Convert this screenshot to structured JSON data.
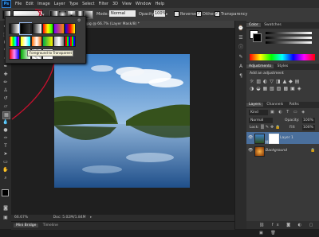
{
  "app": {
    "logo": "Ps"
  },
  "menu": [
    "File",
    "Edit",
    "Image",
    "Layer",
    "Type",
    "Select",
    "Filter",
    "3D",
    "View",
    "Window",
    "Help"
  ],
  "options": {
    "mode_label": "Mode:",
    "mode_value": "Normal",
    "opacity_label": "Opacity:",
    "opacity_value": "100%",
    "reverse_label": "Reverse",
    "dither_label": "Dither",
    "transparency_label": "Transparency"
  },
  "gradient_picker": {
    "tooltip": "Foreground to Transparent"
  },
  "document": {
    "tab_title": "IMG_2368.jpg @ 66.7% (Layer Mask/8) *",
    "zoom": "66.67%",
    "doc_info": "Doc: 5.02M/1.84M"
  },
  "bottom_tabs": [
    "Mini Bridge",
    "Timeline"
  ],
  "color_panel": {
    "tabs": [
      "Color",
      "Swatches"
    ]
  },
  "adjustments_panel": {
    "tabs": [
      "Adjustments",
      "Styles"
    ],
    "heading": "Add an adjustment"
  },
  "layers_panel": {
    "tabs": [
      "Layers",
      "Channels",
      "Paths"
    ],
    "kind_label": "Kind",
    "blend_mode": "Normal",
    "opacity_label": "Opacity:",
    "opacity_value": "100%",
    "lock_label": "Lock:",
    "fill_label": "Fill:",
    "fill_value": "100%",
    "layers": [
      {
        "name": "Layer 1"
      },
      {
        "name": "Background"
      }
    ]
  },
  "colors": {
    "accent": "#c8102e",
    "selection": "#4a6f9c"
  }
}
